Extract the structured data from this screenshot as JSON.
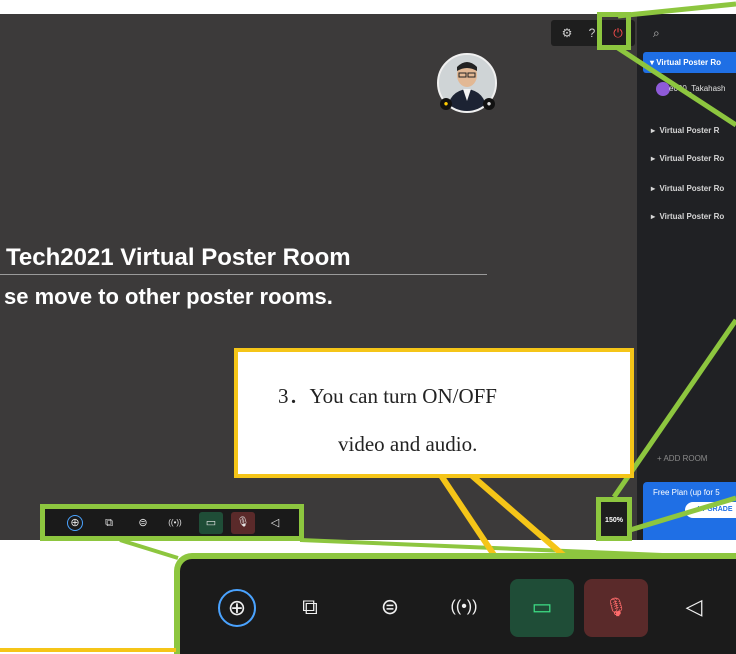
{
  "stage": {
    "banner_line1": "Tech2021 Virtual Poster Room",
    "banner_line2": "se move to other poster rooms."
  },
  "sidebar": {
    "active_room": "▾  Virtual Poster Ro",
    "user_name": "e000_Takahash",
    "rooms": [
      "Virtual Poster R",
      "Virtual Poster Ro",
      "Virtual Poster Ro",
      "Virtual Poster Ro"
    ],
    "add_room": "+   ADD ROOM",
    "plan_text": "Free Plan (up for 5",
    "upgrade_label": "UPGRADE"
  },
  "zoom": {
    "level": "150%"
  },
  "callout": {
    "line1": "3．You can turn ON/OFF",
    "line2": "video and audio."
  },
  "icons": {
    "settings": "⚙",
    "help": "?",
    "power": "⏻",
    "search": "⌕",
    "add": "⊕",
    "screen_share": "⧉",
    "chat": "⊜",
    "broadcast": "((•))",
    "video": "▭",
    "mic_off": "🎙",
    "megaphone": "◁"
  },
  "colors": {
    "highlight_green": "#8dc63f",
    "callout_yellow": "#f5c518",
    "accent_blue": "#1f6fe5",
    "video_on": "#1f4d37",
    "mic_off": "#5a2a2a",
    "power_red": "#ff4d4d"
  }
}
